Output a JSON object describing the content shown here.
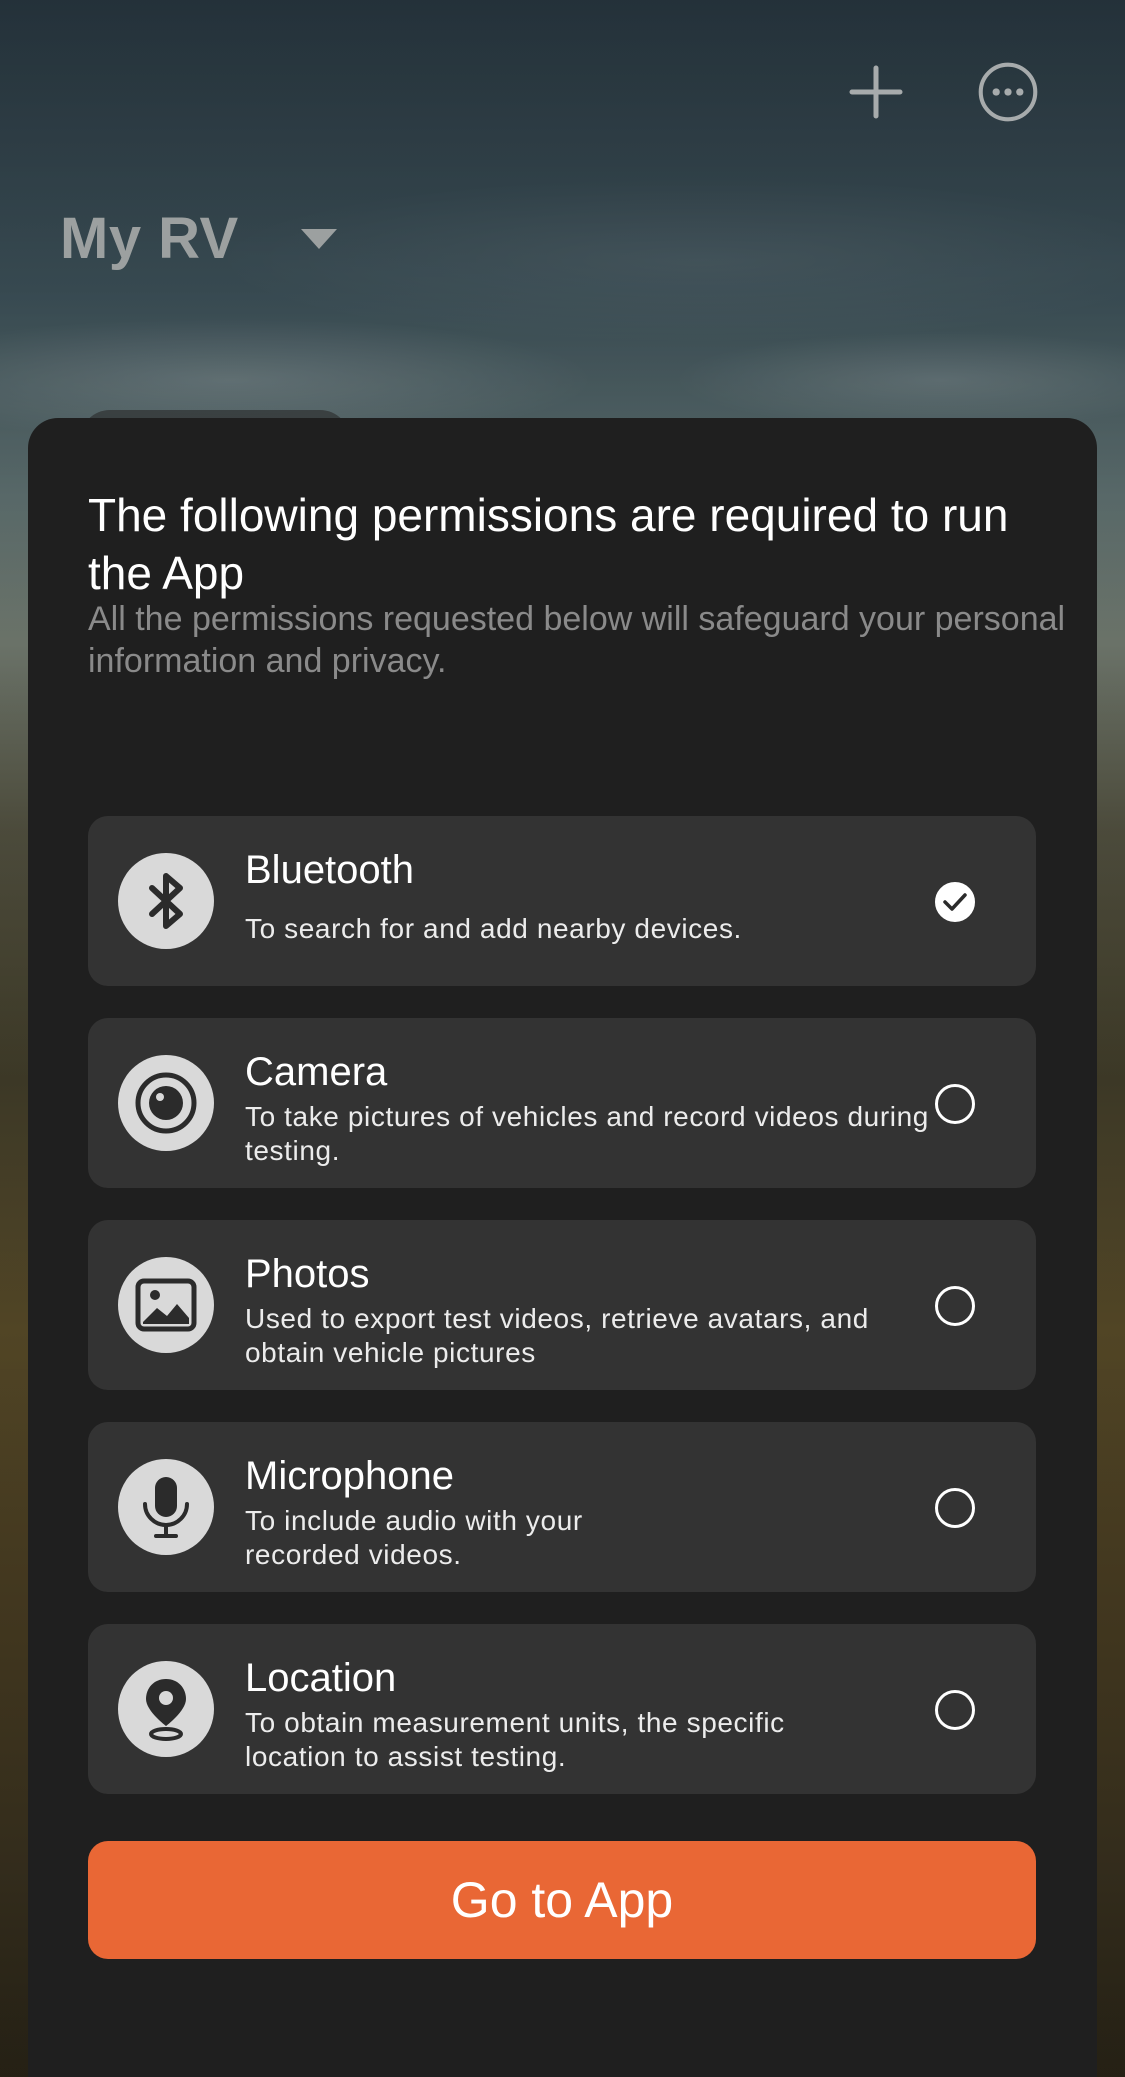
{
  "header": {
    "add_icon": "plus-icon",
    "more_icon": "more-circle-icon",
    "vehicle_name": "My RV",
    "vehicle_caret_icon": "caret-down-icon"
  },
  "dialog": {
    "title": "The following permissions are required to run the App",
    "subtitle": "All the permissions requested below will safeguard your personal information and privacy.",
    "permissions": [
      {
        "name": "Bluetooth",
        "description": "To search for and add nearby devices.",
        "icon": "bluetooth-icon",
        "checked": true
      },
      {
        "name": "Camera",
        "description": "To take pictures of vehicles and record videos during testing.",
        "icon": "camera-icon",
        "checked": false
      },
      {
        "name": "Photos",
        "description": "Used to export test videos, retrieve avatars, and obtain vehicle pictures",
        "icon": "photos-icon",
        "checked": false
      },
      {
        "name": "Microphone",
        "description": "To include audio with your recorded videos.",
        "icon": "microphone-icon",
        "checked": false
      },
      {
        "name": "Location",
        "description": "To obtain measurement units, the specific location to assist testing.",
        "icon": "location-icon",
        "checked": false
      }
    ],
    "go_button_label": "Go to App"
  },
  "colors": {
    "accent": "#e96735",
    "sheet_bg": "#1f1f1f",
    "card_bg": "#333333"
  }
}
